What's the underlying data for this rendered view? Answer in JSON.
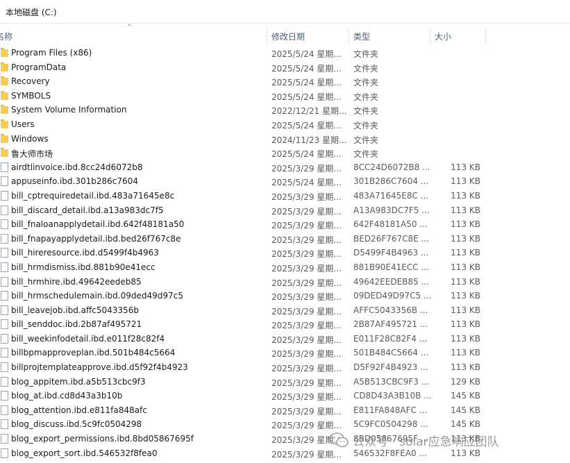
{
  "breadcrumb": {
    "path": "本地磁盘 (C:)"
  },
  "columns": {
    "name": "名称",
    "date": "修改日期",
    "type": "类型",
    "size": "大小"
  },
  "folder_type": "文件夹",
  "rows": [
    {
      "kind": "folder",
      "name": "Program Files (x86)",
      "date": "2025/5/24 星期...",
      "type": "文件夹",
      "size": ""
    },
    {
      "kind": "folder",
      "name": "ProgramData",
      "date": "2025/5/24 星期...",
      "type": "文件夹",
      "size": ""
    },
    {
      "kind": "folder",
      "name": "Recovery",
      "date": "2025/5/24 星期...",
      "type": "文件夹",
      "size": ""
    },
    {
      "kind": "folder",
      "name": "SYMBOLS",
      "date": "2025/5/24 星期...",
      "type": "文件夹",
      "size": ""
    },
    {
      "kind": "folder",
      "name": "System Volume Information",
      "date": "2022/12/21 星期...",
      "type": "文件夹",
      "size": ""
    },
    {
      "kind": "folder",
      "name": "Users",
      "date": "2025/5/24 星期...",
      "type": "文件夹",
      "size": ""
    },
    {
      "kind": "folder",
      "name": "Windows",
      "date": "2024/11/23 星期...",
      "type": "文件夹",
      "size": ""
    },
    {
      "kind": "folder",
      "name": "鲁大师市场",
      "date": "2025/5/24 星期...",
      "type": "文件夹",
      "size": ""
    },
    {
      "kind": "file",
      "name": "airdtlinvoice.ibd.8cc24d6072b8",
      "date": "2025/3/29 星期...",
      "type": "8CC24D6072B8 ...",
      "size": "113 KB"
    },
    {
      "kind": "file",
      "name": "appuseinfo.ibd.301b286c7604",
      "date": "2025/5/24 星期...",
      "type": "301B286C7604 ...",
      "size": "113 KB"
    },
    {
      "kind": "file",
      "name": "bill_cptrequiredetail.ibd.483a71645e8c",
      "date": "2025/3/29 星期...",
      "type": "483A71645E8C ...",
      "size": "113 KB"
    },
    {
      "kind": "file",
      "name": "bill_discard_detail.ibd.a13a983dc7f5",
      "date": "2025/3/29 星期...",
      "type": "A13A983DC7F5 ...",
      "size": "113 KB"
    },
    {
      "kind": "file",
      "name": "bill_fnaloanapplydetail.ibd.642f48181a50",
      "date": "2025/3/29 星期...",
      "type": "642F48181A50 ...",
      "size": "113 KB"
    },
    {
      "kind": "file",
      "name": "bill_fnapayapplydetail.ibd.bed26f767c8e",
      "date": "2025/3/29 星期...",
      "type": "BED26F767C8E ...",
      "size": "113 KB"
    },
    {
      "kind": "file",
      "name": "bill_hireresource.ibd.d5499f4b4963",
      "date": "2025/3/29 星期...",
      "type": "D5499F4B4963 ...",
      "size": "113 KB"
    },
    {
      "kind": "file",
      "name": "bill_hrmdismiss.ibd.881b90e41ecc",
      "date": "2025/3/29 星期...",
      "type": "881B90E41ECC ...",
      "size": "113 KB"
    },
    {
      "kind": "file",
      "name": "bill_hrmhire.ibd.49642eedeb85",
      "date": "2025/3/29 星期...",
      "type": "49642EEDEB85 ...",
      "size": "113 KB"
    },
    {
      "kind": "file",
      "name": "bill_hrmschedulemain.ibd.09ded49d97c5",
      "date": "2025/3/29 星期...",
      "type": "09DED49D97C5 ...",
      "size": "113 KB"
    },
    {
      "kind": "file",
      "name": "bill_leavejob.ibd.affc5043356b",
      "date": "2025/3/29 星期...",
      "type": "AFFC5043356B ...",
      "size": "113 KB"
    },
    {
      "kind": "file",
      "name": "bill_senddoc.ibd.2b87af495721",
      "date": "2025/3/29 星期...",
      "type": "2B87AF495721 ...",
      "size": "113 KB"
    },
    {
      "kind": "file",
      "name": "bill_weekinfodetail.ibd.e011f28c82f4",
      "date": "2025/3/29 星期...",
      "type": "E011F28C82F4 ...",
      "size": "113 KB"
    },
    {
      "kind": "file",
      "name": "billbpmapproveplan.ibd.501b484c5664",
      "date": "2025/3/29 星期...",
      "type": "501B484C5664 ...",
      "size": "113 KB"
    },
    {
      "kind": "file",
      "name": "billprojtemplateapprove.ibd.d5f92f4b4923",
      "date": "2025/3/29 星期...",
      "type": "D5F92F4B4923 ...",
      "size": "113 KB"
    },
    {
      "kind": "file",
      "name": "blog_appitem.ibd.a5b513cbc9f3",
      "date": "2025/3/29 星期...",
      "type": "A5B513CBC9F3 ...",
      "size": "129 KB"
    },
    {
      "kind": "file",
      "name": "blog_at.ibd.cd8d43a3b10b",
      "date": "2025/3/29 星期...",
      "type": "CD8D43A3B10B ...",
      "size": "145 KB"
    },
    {
      "kind": "file",
      "name": "blog_attention.ibd.e811fa848afc",
      "date": "2025/3/29 星期...",
      "type": "E811FA848AFC ...",
      "size": "145 KB"
    },
    {
      "kind": "file",
      "name": "blog_discuss.ibd.5c9fc0504298",
      "date": "2025/3/29 星期...",
      "type": "5C9FC0504298 ...",
      "size": "145 KB"
    },
    {
      "kind": "file",
      "name": "blog_export_permissions.ibd.8bd05867695f",
      "date": "2025/3/29 星期...",
      "type": "8BD05867695F ...",
      "size": "113 KB"
    },
    {
      "kind": "file",
      "name": "blog_export_sort.ibd.546532f8fea0",
      "date": "2025/3/29 星期...",
      "type": "546532F8FEA0 ...",
      "size": "113 KB"
    }
  ],
  "watermark": {
    "text": "公众号 · solar应急响应团队",
    "icon": "wechat-icon"
  }
}
